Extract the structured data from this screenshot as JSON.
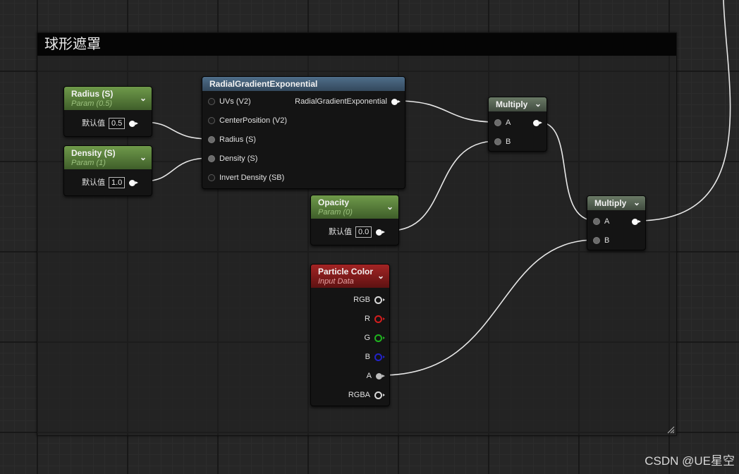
{
  "comment": {
    "title": "球形遮罩"
  },
  "nodes": {
    "radius": {
      "title": "Radius (S)",
      "subtitle": "Param (0.5)",
      "default_label": "默认值",
      "value": "0.5"
    },
    "density": {
      "title": "Density (S)",
      "subtitle": "Param (1)",
      "default_label": "默认值",
      "value": "1.0"
    },
    "radial": {
      "title": "RadialGradientExponential",
      "inputs": [
        "UVs (V2)",
        "CenterPosition (V2)",
        "Radius (S)",
        "Density (S)",
        "Invert Density (SB)"
      ],
      "output": "RadialGradientExponential"
    },
    "opacity": {
      "title": "Opacity",
      "subtitle": "Param (0)",
      "default_label": "默认值",
      "value": "0.0"
    },
    "particle_color": {
      "title": "Particle Color",
      "subtitle": "Input Data",
      "outputs": [
        "RGB",
        "R",
        "G",
        "B",
        "A",
        "RGBA"
      ]
    },
    "multiply1": {
      "title": "Multiply",
      "inputs": [
        "A",
        "B"
      ]
    },
    "multiply2": {
      "title": "Multiply",
      "inputs": [
        "A",
        "B"
      ]
    }
  },
  "colors": {
    "param_header": "#5a8040",
    "function_header": "#3f5a73",
    "operator_header": "#56634f",
    "input_data_header": "#8a1c1c",
    "pin_r": "#d41e1e",
    "pin_g": "#1fb31f",
    "pin_b": "#2323c8"
  },
  "watermark": "CSDN @UE星空"
}
